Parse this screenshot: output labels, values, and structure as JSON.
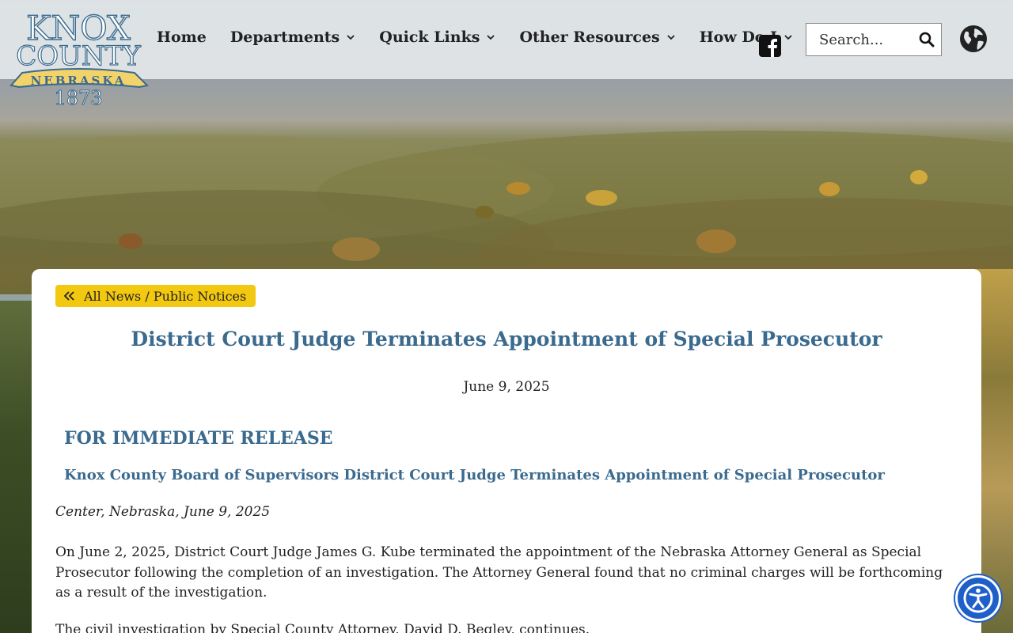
{
  "header": {
    "logo": {
      "line1": "KNOX",
      "line2": "COUNTY",
      "banner": "NEBRASKA",
      "year": "1873"
    },
    "nav": [
      {
        "label": "Home",
        "has_dropdown": false
      },
      {
        "label": "Departments",
        "has_dropdown": true
      },
      {
        "label": "Quick Links",
        "has_dropdown": true
      },
      {
        "label": "Other Resources",
        "has_dropdown": true
      },
      {
        "label": "How Do I",
        "has_dropdown": true
      }
    ],
    "social_icon": "facebook-icon",
    "search": {
      "placeholder": "Search...",
      "value": ""
    },
    "language_icon": "globe-icon"
  },
  "article": {
    "back_label": "All News / Public Notices",
    "title": "District Court Judge Terminates Appointment of Special Prosecutor",
    "date": "June 9, 2025",
    "release_heading": "FOR IMMEDIATE RELEASE",
    "subheading": "Knox County Board of Supervisors District Court Judge Terminates Appointment of Special Prosecutor",
    "dateline": "Center, Nebraska, June 9, 2025",
    "paragraph1": "On June 2, 2025, District Court Judge James G. Kube terminated the appointment of the Nebraska Attorney General as Special Prosecutor following the completion of an investigation. The Attorney General found that no criminal charges will be forthcoming as a result of the investigation.",
    "paragraph2": "The civil investigation by Special County Attorney, David D. Begley, continues."
  },
  "accessibility_button": "accessibility-icon",
  "colors": {
    "accent_blue": "#3a6a8e",
    "button_yellow": "#f2c811",
    "header_bg": "#e1e6e9",
    "a11y_blue": "#1f5fc9"
  }
}
